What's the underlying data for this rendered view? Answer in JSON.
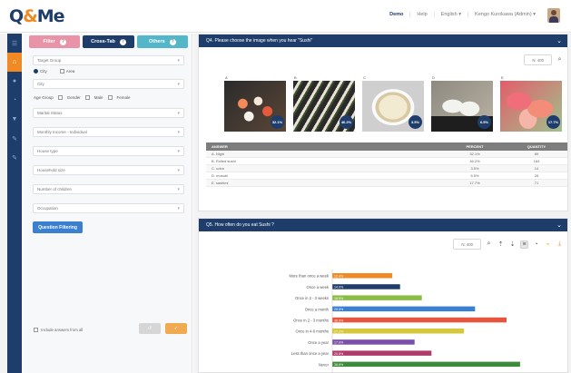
{
  "app": {
    "logo_left": "Q",
    "logo_amp": "&",
    "logo_right": "Me"
  },
  "topnav": [
    "Demo",
    "Help",
    "English ▾",
    "Kengo Kurokawa (Admin) ▾"
  ],
  "rail_icons": [
    "menu-icon",
    "home-icon",
    "pin-icon",
    "chart-icon",
    "filter-icon",
    "edit-icon",
    "edit-icon"
  ],
  "filter_tabs": [
    {
      "label": "Filter",
      "color": "#e993a8"
    },
    {
      "label": "Cross-Tab",
      "color": "#1e3d6b"
    },
    {
      "label": "Others",
      "color": "#54b6c9"
    }
  ],
  "filters": {
    "target_group": "Target Group",
    "region_options": [
      "City",
      "Area"
    ],
    "region_selected": "City",
    "city": "City",
    "age_group": "Age Group",
    "gender_label": "Gender",
    "gender_options": [
      "Male",
      "Female"
    ],
    "marital_status": "Marital Status",
    "monthly_income": "Monthly Income - Individual",
    "house_type": "House type",
    "household_size": "Household size",
    "num_children": "Number of children",
    "occupation": "Occupation",
    "question_filtering": "Question Filtering",
    "include_answers": "Include answers from all",
    "btn_a": "↺",
    "btn_b": "✓"
  },
  "q1": {
    "title": "Q4. Please choose the image when you hear \"Sushi\"",
    "n_label": "N: 400",
    "images": [
      {
        "label": "A",
        "pct": "32.1%"
      },
      {
        "label": "B",
        "pct": "46.2%"
      },
      {
        "label": "C",
        "pct": "3.5%"
      },
      {
        "label": "D",
        "pct": "6.5%"
      },
      {
        "label": "E",
        "pct": "17.7%"
      }
    ],
    "table": {
      "headers": [
        "ANSWER",
        "PERCENT",
        "QUANTITY"
      ],
      "rows": [
        [
          "A. Nigiri",
          "32.1%",
          "89"
        ],
        [
          "B. Rolled sushi",
          "46.2%",
          "184"
        ],
        [
          "C. udon",
          "3.5%",
          "14"
        ],
        [
          "D. musubi",
          "6.5%",
          "26"
        ],
        [
          "E. sashimi",
          "17.7%",
          "71"
        ]
      ]
    }
  },
  "q2": {
    "title": "Q5. How often do you eat Sushi ?",
    "n_label": "N: 400"
  },
  "chart_data": {
    "type": "bar",
    "orientation": "horizontal",
    "categories": [
      "More than once a week",
      "Once a week",
      "Once in 2 - 3 weeks",
      "Once a month",
      "Once in 2 - 3 months",
      "Once in 4-6 months",
      "Once a year",
      "Less than once a year",
      "Never"
    ],
    "values": [
      12.4,
      14.0,
      18.5,
      29.5,
      36.0,
      27.2,
      17.0,
      20.5,
      38.8
    ],
    "value_labels": [
      "12.4%",
      "14.0%",
      "18.5%",
      "29.5%",
      "36.0%",
      "27.2%",
      "17.0%",
      "20.5%",
      "38.8%"
    ],
    "colors": [
      "#f08a24",
      "#1e3d6b",
      "#8bbd45",
      "#3a7fd0",
      "#e8553e",
      "#d5c83a",
      "#7a4fa8",
      "#b03a6a",
      "#3c8a3c"
    ],
    "xlim": [
      0,
      45
    ],
    "grid": false
  }
}
